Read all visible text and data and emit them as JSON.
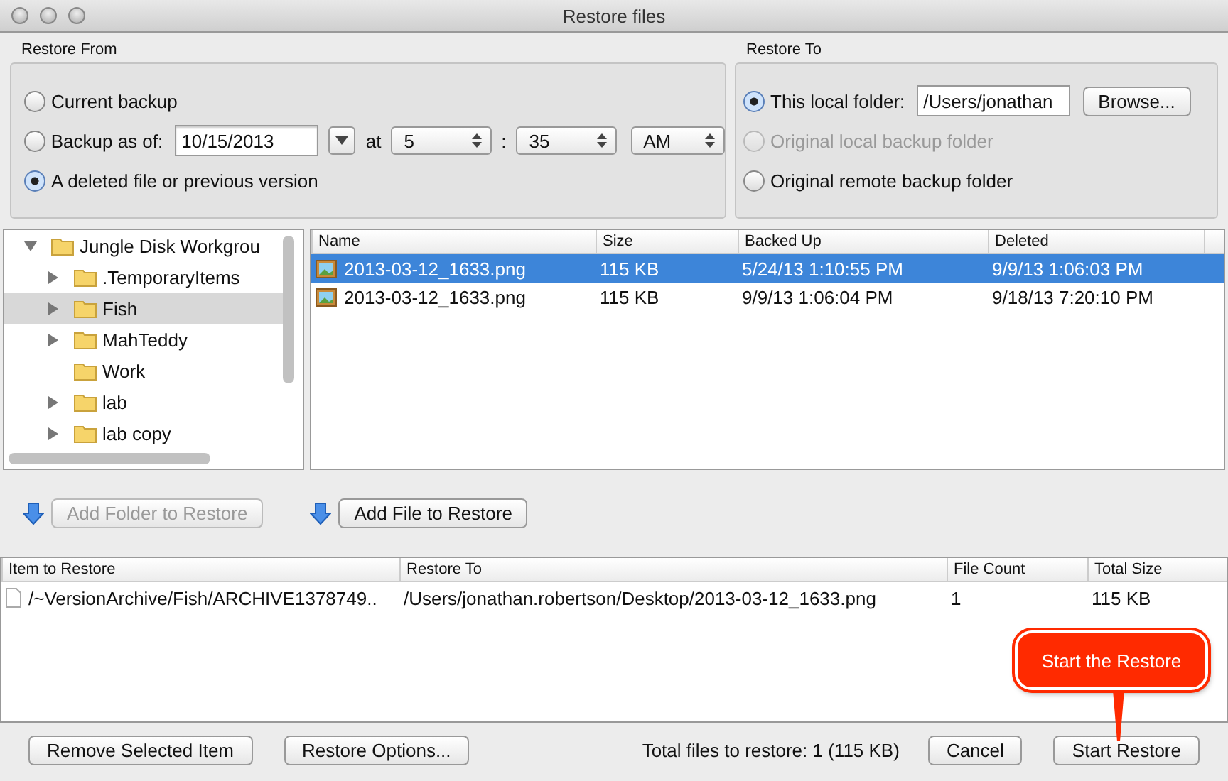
{
  "window": {
    "title": "Restore files"
  },
  "restore_from": {
    "label": "Restore From",
    "options": [
      {
        "label": "Current backup",
        "selected": false
      },
      {
        "label": "Backup as of:",
        "selected": false
      },
      {
        "label": "A deleted file or previous version",
        "selected": true
      }
    ],
    "date": "10/15/2013",
    "at": "at",
    "hour": "5",
    "separator": ":",
    "minute": "35",
    "ampm": "AM"
  },
  "restore_to": {
    "label": "Restore To",
    "options": [
      {
        "label": "This local folder:",
        "selected": true,
        "disabled": false
      },
      {
        "label": "Original local backup folder",
        "selected": false,
        "disabled": true
      },
      {
        "label": "Original remote backup folder",
        "selected": false,
        "disabled": false
      }
    ],
    "folder": "/Users/jonathan",
    "browse": "Browse..."
  },
  "tree": {
    "items": [
      {
        "label": "Jungle Disk Workgrou",
        "expanded": true,
        "selected": false,
        "children": [
          {
            "label": ".TemporaryItems",
            "expanded": false,
            "selected": false
          },
          {
            "label": "Fish",
            "expanded": false,
            "selected": true
          },
          {
            "label": "MahTeddy",
            "expanded": false,
            "selected": false
          },
          {
            "label": "Work",
            "selected": false
          },
          {
            "label": "lab",
            "expanded": false,
            "selected": false
          },
          {
            "label": "lab copy",
            "expanded": false,
            "selected": false
          }
        ]
      }
    ]
  },
  "files": {
    "columns": [
      "Name",
      "Size",
      "Backed Up",
      "Deleted"
    ],
    "rows": [
      {
        "cells": [
          "2013-03-12_1633.png",
          "115 KB",
          "5/24/13 1:10:55 PM",
          "9/9/13 1:06:03 PM"
        ],
        "selected": true
      },
      {
        "cells": [
          "2013-03-12_1633.png",
          "115 KB",
          "9/9/13 1:06:04 PM",
          "9/18/13 7:20:10 PM"
        ],
        "selected": false
      }
    ]
  },
  "add_buttons": [
    {
      "label": "Add Folder to Restore",
      "disabled": true
    },
    {
      "label": "Add File to Restore",
      "disabled": false
    }
  ],
  "queue": {
    "columns": [
      "Item to Restore",
      "Restore To",
      "File Count",
      "Total Size"
    ],
    "rows": [
      {
        "cells": [
          "/~VersionArchive/Fish/ARCHIVE1378749..",
          "/Users/jonathan.robertson/Desktop/2013-03-12_1633.png",
          "1",
          "115 KB"
        ]
      }
    ]
  },
  "footer": {
    "buttons_left": [
      "Remove Selected Item",
      "Restore Options..."
    ],
    "total": "Total files to restore: 1 (115 KB)",
    "buttons_right": [
      "Cancel",
      "Start Restore"
    ]
  },
  "callout": {
    "text": "Start the Restore"
  }
}
